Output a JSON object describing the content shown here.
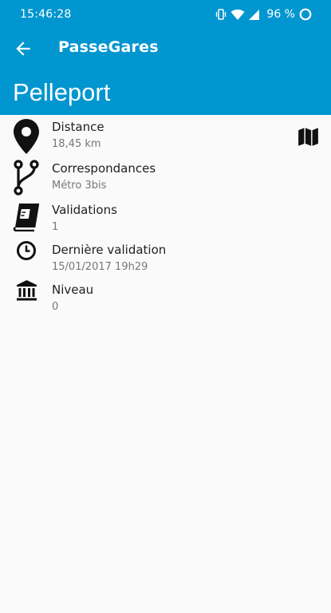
{
  "status_bar": {
    "time": "15:46:28",
    "battery": "96 %",
    "icons": [
      "vibrate-icon",
      "wifi-icon",
      "signal-icon",
      "battery-ring-icon"
    ]
  },
  "app_bar": {
    "title": "PasseGares",
    "back_icon": "arrow-left-icon",
    "station_name": "Pelleport"
  },
  "details": [
    {
      "icon": "map-pin-icon",
      "label": "Distance",
      "value": "18,45 km"
    },
    {
      "icon": "branch-icon",
      "label": "Correspondances",
      "value": "Métro 3bis"
    },
    {
      "icon": "book-icon",
      "label": "Validations",
      "value": "1"
    },
    {
      "icon": "clock-icon",
      "label": "Dernière validation",
      "value": "15/01/2017 19h29"
    },
    {
      "icon": "bank-icon",
      "label": "Niveau",
      "value": "0"
    }
  ],
  "actions": {
    "map_icon": "map-icon"
  },
  "colors": {
    "primary": "#0196cf",
    "background": "#fafafa",
    "text": "#1f1f1f",
    "secondary_text": "#777777"
  }
}
